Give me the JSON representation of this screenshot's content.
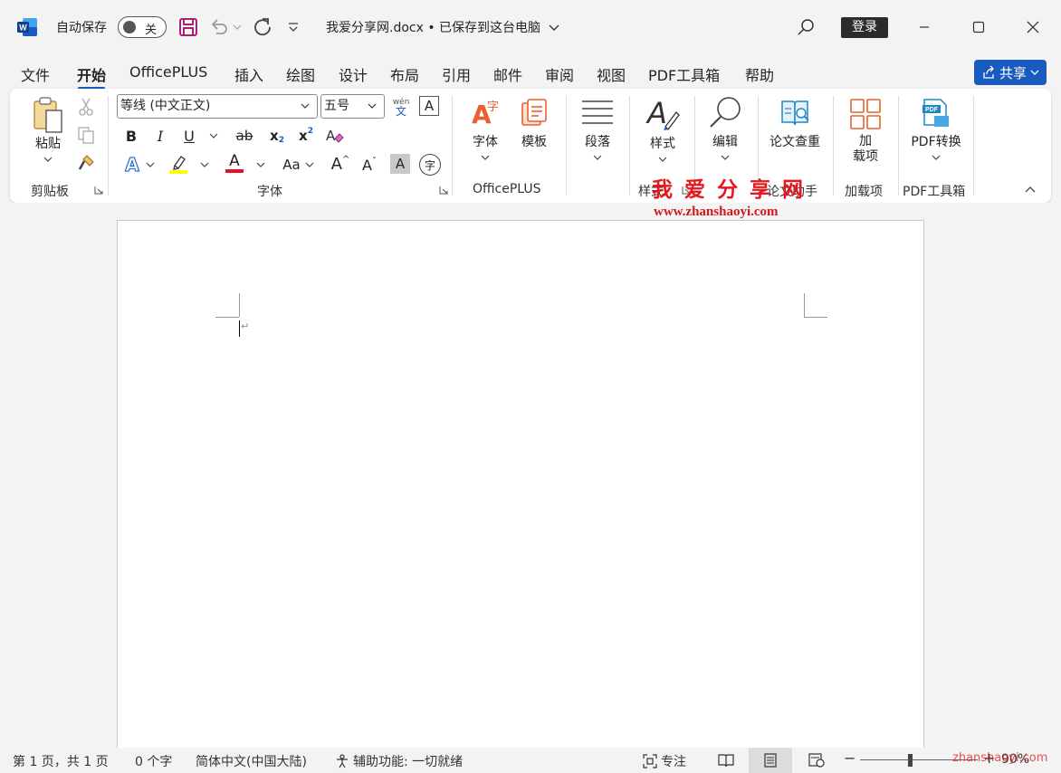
{
  "titlebar": {
    "autosave_label": "自动保存",
    "autosave_state": "关",
    "document_title": "我爱分享网.docx • 已保存到这台电脑",
    "login_label": "登录"
  },
  "menu": {
    "tabs": [
      "文件",
      "开始",
      "OfficePLUS",
      "插入",
      "绘图",
      "设计",
      "布局",
      "引用",
      "邮件",
      "审阅",
      "视图",
      "PDF工具箱",
      "帮助"
    ],
    "active_tab": "开始",
    "share_label": "共享"
  },
  "ribbon": {
    "clipboard": {
      "paste_label": "粘贴",
      "group_label": "剪贴板"
    },
    "font": {
      "font_name": "等线 (中文正文)",
      "font_size": "五号",
      "phonetic_top": "wén",
      "phonetic_bottom": "文",
      "border_char": "A",
      "bold": "B",
      "italic": "I",
      "underline": "U",
      "strike": "ab",
      "subscript": "x",
      "sub_mark": "2",
      "superscript": "x",
      "sup_mark": "2",
      "text_effect": "A",
      "font_color_char": "A",
      "change_case": "Aa",
      "grow": "A",
      "shrink": "A",
      "shade_char": "A",
      "enclose_char": "字",
      "group_label": "字体"
    },
    "officeplus": {
      "font_label": "字体",
      "font_icon_char": "A",
      "font_icon_sub": "字",
      "template_label": "模板",
      "group_label": "OfficePLUS"
    },
    "paragraph": {
      "label": "段落"
    },
    "styles": {
      "label": "样式",
      "group_label": "样式"
    },
    "editing": {
      "label": "编辑"
    },
    "thesis": {
      "label": "论文查重",
      "group_label": "论文助手"
    },
    "addins": {
      "label_line1": "加",
      "label_line2": "载项",
      "group_label": "加载项"
    },
    "pdf": {
      "label": "PDF转换",
      "icon_text": "PDF",
      "group_label": "PDF工具箱"
    }
  },
  "watermark": {
    "title": "我爱分享网",
    "url": "www.zhanshaoyi.com",
    "status_url": "zhanshaoyi.com"
  },
  "statusbar": {
    "page_info": "第 1 页，共 1 页",
    "word_count": "0 个字",
    "language": "简体中文(中国大陆)",
    "accessibility": "辅助功能: 一切就绪",
    "focus_label": "专注",
    "zoom": "90%"
  },
  "colors": {
    "accent": "#185abd",
    "highlight": "#ffff00",
    "font_color": "#e81123",
    "officeplus_orange": "#e8612c",
    "watermark_red": "#e8161e"
  }
}
